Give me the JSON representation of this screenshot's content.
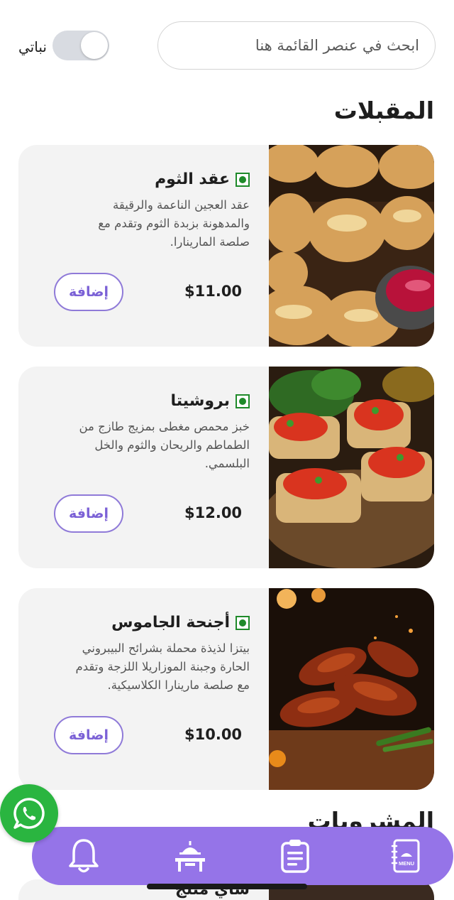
{
  "search": {
    "placeholder": "ابحث في عنصر القائمة هنا"
  },
  "filter": {
    "veg_label": "نباتي",
    "veg_on": false
  },
  "sections": [
    {
      "title": "المقبلات",
      "items": [
        {
          "name": "عقد الثوم",
          "description": "عقد العجين الناعمة والرقيقة والمدهونة بزبدة الثوم وتقدم مع صلصة المارينارا.",
          "price": "$11.00",
          "add_label": "إضافة"
        },
        {
          "name": "بروشيتا",
          "description": "خبز محمص مغطى بمزيج طازج من الطماطم والريحان والثوم والخل البلسمي.",
          "price": "$12.00",
          "add_label": "إضافة"
        },
        {
          "name": "أجنحة الجاموس",
          "description": "بيتزا لذيذة محملة بشرائح البيبروني الحارة وجبنة الموزاريلا اللزجة وتقدم مع صلصة مارينارا الكلاسيكية.",
          "price": "$10.00",
          "add_label": "إضافة"
        }
      ]
    },
    {
      "title": "المشروبات",
      "items": [
        {
          "name": "شاي مثلج"
        }
      ]
    }
  ],
  "nav": {
    "items": [
      {
        "icon": "bell-icon"
      },
      {
        "icon": "table-service-icon"
      },
      {
        "icon": "order-clipboard-icon"
      },
      {
        "icon": "menu-book-icon",
        "badge_text": "MENU"
      }
    ]
  },
  "colors": {
    "accent": "#9574e8",
    "veg_green": "#1f8a2a",
    "whatsapp": "#2ab540"
  }
}
